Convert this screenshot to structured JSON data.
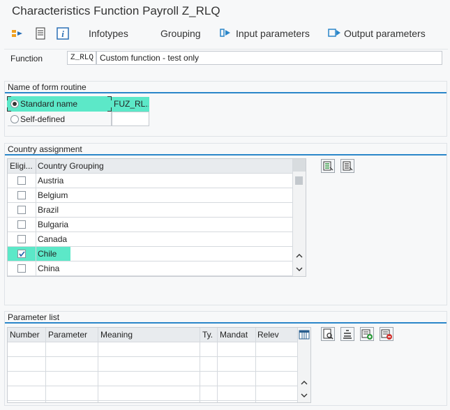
{
  "window": {
    "title": "Characteristics Function Payroll Z_RLQ"
  },
  "toolbar": {
    "infotypes": "Infotypes",
    "grouping": "Grouping",
    "input_parameters": "Input parameters",
    "output_parameters": "Output parameters"
  },
  "function": {
    "label": "Function",
    "code": "Z_RLQ",
    "description": "Custom function - test only"
  },
  "form_routine": {
    "title": "Name of form routine",
    "standard_label": "Standard name",
    "standard_value": "FUZ_RL...",
    "selfdefined_label": "Self-defined",
    "selected": "standard"
  },
  "country": {
    "title": "Country assignment",
    "headers": {
      "eligible": "Eligi...",
      "grouping": "Country Grouping"
    },
    "rows": [
      {
        "name": "Austria",
        "checked": false
      },
      {
        "name": "Belgium",
        "checked": false
      },
      {
        "name": "Brazil",
        "checked": false
      },
      {
        "name": "Bulgaria",
        "checked": false
      },
      {
        "name": "Canada",
        "checked": false
      },
      {
        "name": "Chile",
        "checked": true
      },
      {
        "name": "China",
        "checked": false
      }
    ]
  },
  "params": {
    "title": "Parameter list",
    "headers": {
      "number": "Number",
      "parameter": "Parameter",
      "meaning": "Meaning",
      "type": "Ty.",
      "mandatory": "Mandat",
      "relevant": "Relev"
    },
    "empty_rows": 4
  },
  "colors": {
    "highlight": "#5ce8c8",
    "accent": "#2a86c9"
  }
}
